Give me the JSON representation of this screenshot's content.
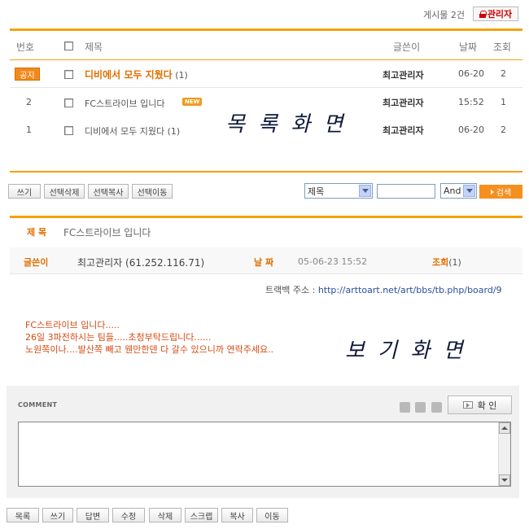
{
  "top": {
    "post_count": "게시물 2건",
    "admin_label": "관리자"
  },
  "table": {
    "headers": {
      "num": "번호",
      "title": "제목",
      "author": "글쓴이",
      "date": "날짜",
      "views": "조회"
    },
    "rows": [
      {
        "num": "공지",
        "title": "디비에서 모두 지웠다",
        "comments": "(1)",
        "author": "최고관리자",
        "date": "06-20",
        "views": "2"
      },
      {
        "num": "2",
        "title": "FC스트라이브 입니다",
        "badge": "NEW",
        "author": "최고관리자",
        "date": "15:52",
        "views": "1"
      },
      {
        "num": "1",
        "title": "디비에서 모두 지웠다",
        "comments": "(1)",
        "author": "최고관리자",
        "date": "06-20",
        "views": "2"
      }
    ]
  },
  "annotations": {
    "list": "목 록 화 면",
    "view": "보 기 화 면"
  },
  "list_buttons": [
    "쓰기",
    "선택삭제",
    "선택복사",
    "선택이동"
  ],
  "search": {
    "field": "제목",
    "logic": "And",
    "button": "검색"
  },
  "view": {
    "title_label": "제 목",
    "title": "FC스트라이브 입니다",
    "author_label": "글쓴이",
    "author": "최고관리자 (61.252.116.71)",
    "date_label": "날 짜",
    "date": "05-06-23 15:52",
    "views_label": "조회",
    "views": "(1)",
    "trackback_label": "트랙백 주소 :",
    "trackback_url": "http://arttoart.net/art/bbs/tb.php/board/9",
    "content": [
      "FC스트라이브 입니다.....",
      "26일 3파전하시는 팀들.....초청부탁드립니다......",
      "노원쪽이나....발산쪽 빼고 웬만한덴 다 갈수 있으니까 연락주세요.."
    ]
  },
  "comment": {
    "label": "COMMENT",
    "confirm": "확 인"
  },
  "bottom_buttons": [
    "목록",
    "쓰기",
    "답변",
    "수정",
    "삭제",
    "스크랩",
    "복사",
    "이동"
  ]
}
